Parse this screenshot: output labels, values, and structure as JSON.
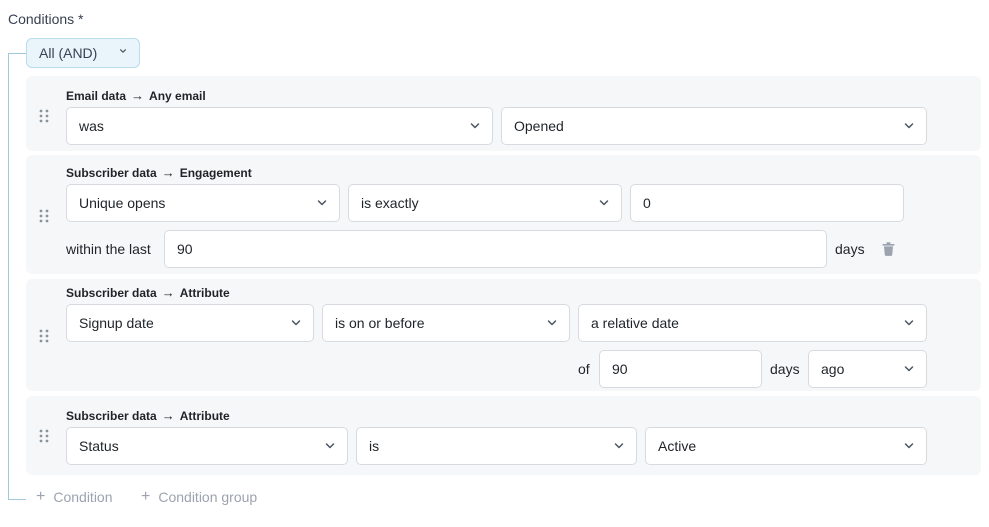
{
  "title": "Conditions *",
  "group": {
    "label": "All (AND)"
  },
  "conditions": [
    {
      "source": "Email data",
      "target": "Any email",
      "field1": "was",
      "field2": "Opened"
    },
    {
      "source": "Subscriber data",
      "target": "Engagement",
      "field1": "Unique opens",
      "operator": "is exactly",
      "value": "0",
      "within_label": "within the last",
      "within_value": "90",
      "unit": "days"
    },
    {
      "source": "Subscriber data",
      "target": "Attribute",
      "field1": "Signup date",
      "operator": "is on or before",
      "value": "a relative date",
      "of_label": "of",
      "of_value": "90",
      "unit": "days",
      "direction": "ago"
    },
    {
      "source": "Subscriber data",
      "target": "Attribute",
      "field1": "Status",
      "operator": "is",
      "value": "Active"
    }
  ],
  "actions": {
    "add_condition": "Condition",
    "add_group": "Condition group"
  },
  "icons": {
    "arrow": "→",
    "plus": "+"
  }
}
